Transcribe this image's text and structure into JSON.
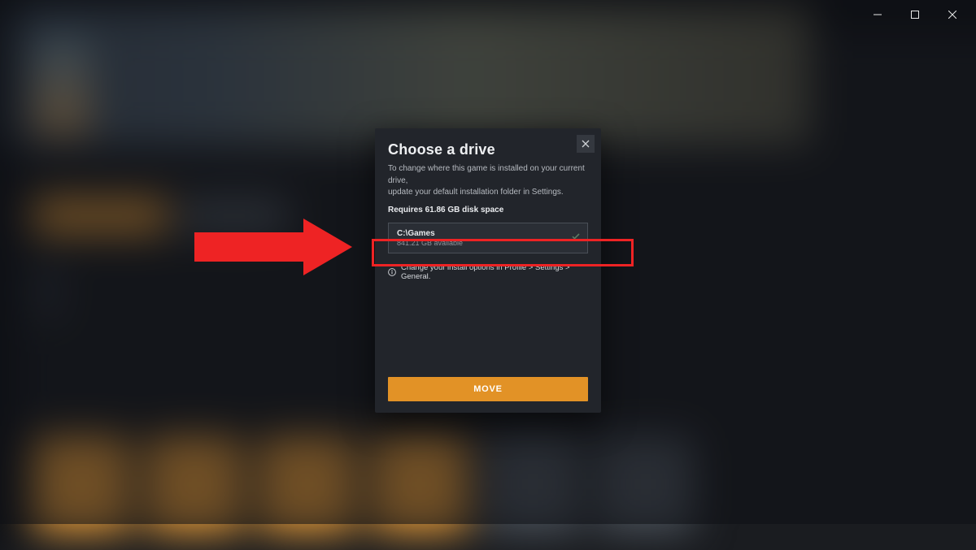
{
  "modal": {
    "title": "Choose a drive",
    "description_line1": "To change where this game is installed on your current drive,",
    "description_line2": "update your default installation folder in Settings.",
    "requires": "Requires 61.86 GB disk space",
    "drive": {
      "path": "C:\\Games",
      "available": "841.21 GB available"
    },
    "info": "Change your install options in Profile > Settings > General.",
    "action": "MOVE"
  },
  "window_buttons": {
    "minimize": "minimize",
    "maximize": "maximize",
    "close": "close"
  }
}
